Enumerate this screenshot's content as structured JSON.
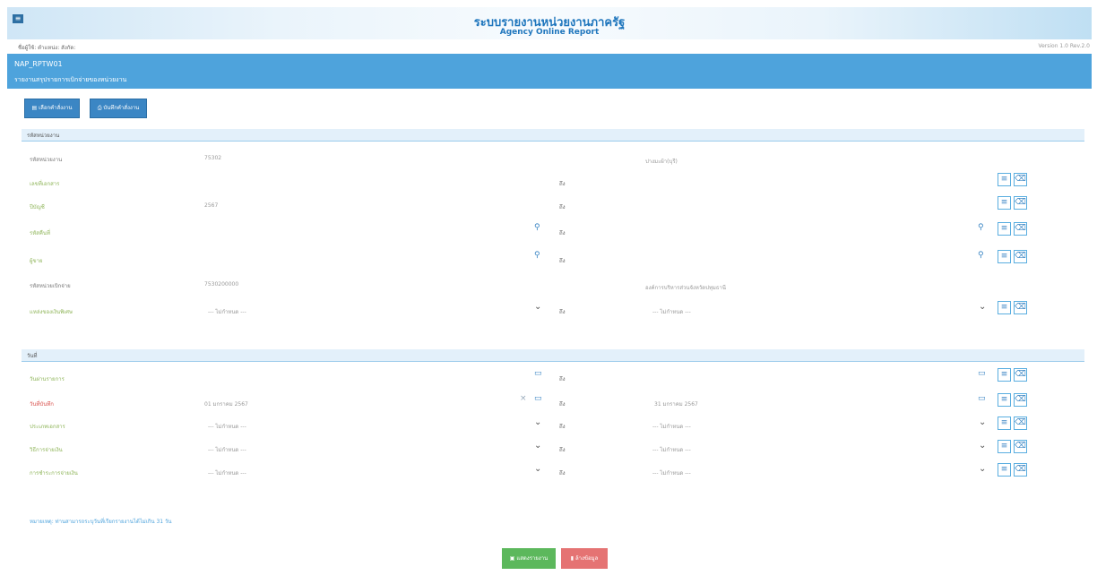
{
  "app": {
    "title_th": "ระบบรายงานหน่วยงานภาครัฐ",
    "title_en": "Agency Online Report",
    "menu_icon": "≡"
  },
  "userbar": {
    "user_info": "ชื่อผู้ใช้:   ตำแหน่ง:   สังกัด:",
    "version": "Version 1.0 Rev.2.0"
  },
  "report": {
    "code": "NAP_RPTW01",
    "title": "รายงานสรุปรายการเบิกจ่ายของหน่วยงาน"
  },
  "toolbar": {
    "select_label": "▤ เลือกคำสั่งงาน",
    "save_label": "⎙ บันทึกคำสั่งงาน"
  },
  "section1": {
    "title": "รหัสหน่วยงาน",
    "rows": [
      {
        "label": "รหัสหน่วยงาน",
        "value": "75302",
        "right": "ปางมะผ้า(บุรี)"
      },
      {
        "label": "เลขที่เอกสาร",
        "to": "ถึง"
      },
      {
        "label": "ปีบัญชี",
        "value": "2567",
        "to": "ถึง"
      },
      {
        "label": "รหัสคืนที่",
        "to": "ถึง"
      },
      {
        "label": "ผู้ขาย",
        "to": "ถึง"
      },
      {
        "label": "รหัสหน่วยเบิกจ่าย",
        "value": "7530200000",
        "right": "องค์การบริหารส่วนจังหวัดปทุมธานี"
      },
      {
        "label": "แหล่งของเงินพิเศษ",
        "value": "--- ไม่กำหนด ---",
        "to": "ถึง",
        "value2": "--- ไม่กำหนด ---"
      }
    ]
  },
  "section2": {
    "title": "วันที่",
    "rows": [
      {
        "label": "วันผ่านรายการ",
        "to": "ถึง"
      },
      {
        "label": "วันที่บันทึก",
        "value": "01 มกราคม 2567",
        "to": "ถึง",
        "value2": "31 มกราคม 2567"
      },
      {
        "label": "ประเภทเอกสาร",
        "value": "--- ไม่กำหนด ---",
        "to": "ถึง",
        "value2": "--- ไม่กำหนด ---"
      },
      {
        "label": "วิธีการจ่ายเงิน",
        "value": "--- ไม่กำหนด ---",
        "to": "ถึง",
        "value2": "--- ไม่กำหนด ---"
      },
      {
        "label": "การชำระการจ่ายเงิน",
        "value": "--- ไม่กำหนด ---",
        "to": "ถึง",
        "value2": "--- ไม่กำหนด ---"
      }
    ]
  },
  "note": "หมายเหตุ: ท่านสามารถระบุวันที่เรียกรายงานได้ไม่เกิน 31 วัน",
  "actions": {
    "report_label": "▣ แสดงรายงาน",
    "clear_label": "▮ ล้างข้อมูล"
  },
  "icons": {
    "search": "⚲",
    "calendar": "▭",
    "chevron": "⌄",
    "clear": "×",
    "list": "≡",
    "trash": "⌫"
  },
  "colors": {
    "header": "#4ea3dc",
    "accent": "#3b86c4",
    "label_green": "#8fb55a",
    "label_red": "#d9534f",
    "report_button": "#5cb85c",
    "clear_button": "#e57373"
  }
}
